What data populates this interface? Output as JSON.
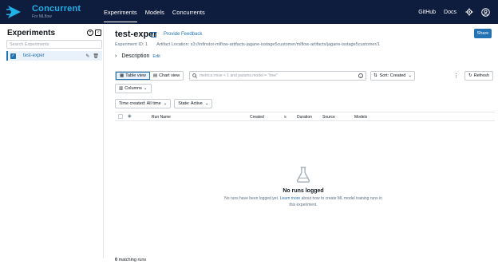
{
  "brand": {
    "name": "Concurrent",
    "sub": "For MLflow",
    "color": "#1fb0e8"
  },
  "nav": {
    "items": [
      {
        "label": "Experiments",
        "active": true
      },
      {
        "label": "Models",
        "active": false
      },
      {
        "label": "Concurrents",
        "active": false
      }
    ],
    "right": {
      "github": "GitHub",
      "docs": "Docs"
    }
  },
  "sidebar": {
    "title": "Experiments",
    "search_placeholder": "Search Experiments",
    "items": [
      {
        "label": "test-exper",
        "selected": true
      }
    ]
  },
  "experiment": {
    "title": "test-exper",
    "feedback": "Provide Feedback",
    "share": "Share",
    "id_text": "Experiment ID: 1",
    "artifact_text": "Artifact Location: s3://infinstor-mlflow-artifacts-jagane-isstage5customer/mlflow-artifacts/jagane-isstage5customer/1",
    "description": "Description",
    "edit": "Edit"
  },
  "toolbar": {
    "table_view": "Table view",
    "chart_view": "Chart view",
    "search_placeholder": "metrics.rmse < 1 and params.model = \"tree\"",
    "sort": "Sort: Created",
    "refresh": "Refresh",
    "columns": "Columns"
  },
  "filters": {
    "time": "Time created: All time",
    "state": "State: Active"
  },
  "table": {
    "headers": [
      "Run Name",
      "Created",
      "Duration",
      "Source",
      "Models"
    ]
  },
  "empty": {
    "title": "No runs logged",
    "text_before": "No runs have been logged yet. ",
    "link": "Learn more",
    "text_after": " about how to create ML model training runs in this experiment."
  },
  "footer": {
    "count": "0",
    "label": "matching runs"
  },
  "colors": {
    "nav_bg": "#0e1c3d",
    "primary": "#2272b4"
  }
}
